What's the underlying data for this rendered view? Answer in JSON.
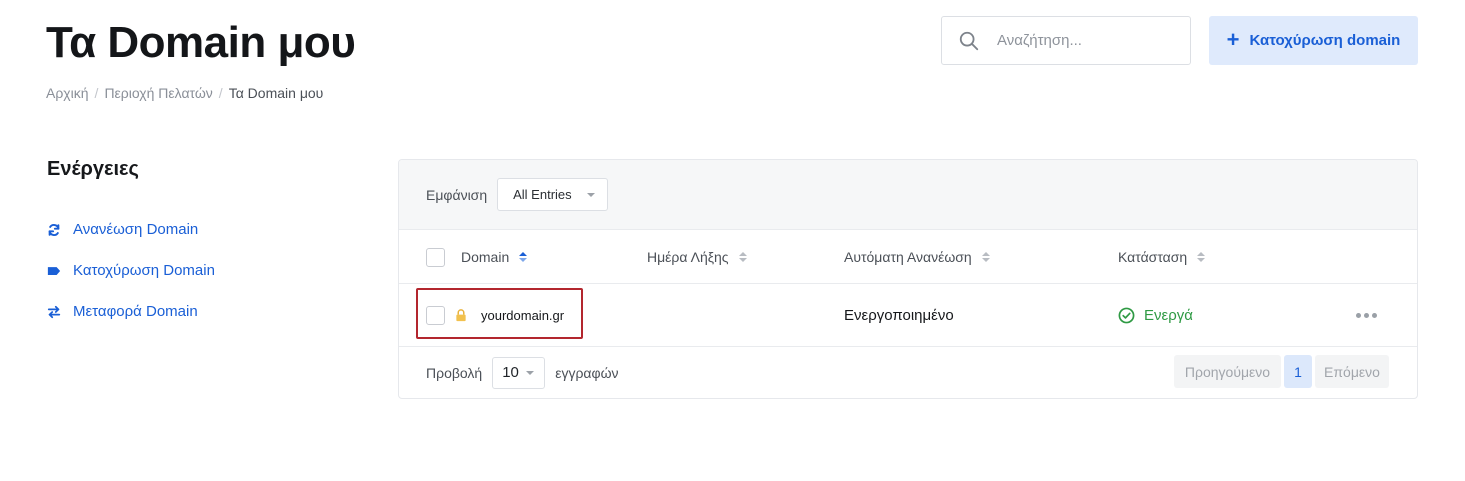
{
  "header": {
    "title": "Τα Domain μου",
    "breadcrumb": [
      "Αρχική",
      "Περιοχή Πελατών",
      "Τα Domain μου"
    ],
    "breadcrumb_separator": "/",
    "search_placeholder": "Αναζήτηση...",
    "register_button": "Κατοχύρωση domain"
  },
  "sidebar": {
    "title": "Ενέργειες",
    "items": [
      {
        "label": "Ανανέωση Domain",
        "icon": "sync-icon"
      },
      {
        "label": "Κατοχύρωση Domain",
        "icon": "tag-icon"
      },
      {
        "label": "Μεταφορά Domain",
        "icon": "transfer-arrows-icon"
      }
    ]
  },
  "table": {
    "show_label": "Εμφάνιση",
    "show_value": "All Entries",
    "columns": [
      "Domain",
      "Ημέρα Λήξης",
      "Αυτόματη Ανανέωση",
      "Κατάσταση"
    ],
    "rows": [
      {
        "domain": "yourdomain.gr",
        "expiry": "",
        "auto_renew": "Ενεργοποιημένο",
        "status": "Ενεργά"
      }
    ],
    "footer": {
      "view_label": "Προβολή",
      "per_page": "10",
      "records_label": "εγγραφών",
      "prev": "Προηγούμενο",
      "page": "1",
      "next": "Επόμενο"
    }
  },
  "colors": {
    "accent": "#1a5fd6",
    "status_active": "#2f9a44",
    "highlight_box": "#b3262e"
  }
}
